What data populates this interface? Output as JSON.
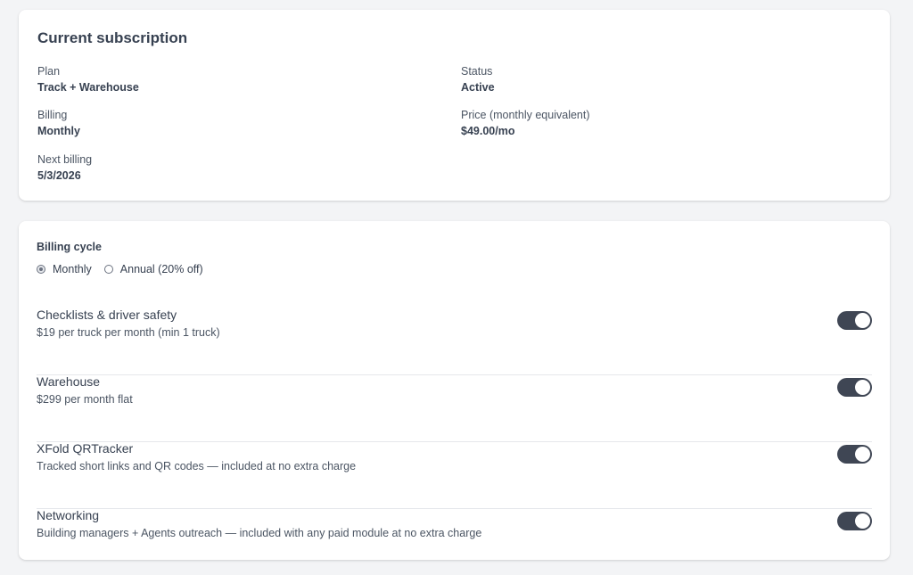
{
  "subscription": {
    "title": "Current subscription",
    "plan": {
      "label": "Plan",
      "value": "Track + Warehouse"
    },
    "status": {
      "label": "Status",
      "value": "Active"
    },
    "billing": {
      "label": "Billing",
      "value": "Monthly"
    },
    "price": {
      "label": "Price (monthly equivalent)",
      "value": "$49.00/mo"
    },
    "next_billing": {
      "label": "Next billing",
      "value": "5/3/2026"
    }
  },
  "billing_cycle": {
    "label": "Billing cycle",
    "options": [
      {
        "label": "Monthly",
        "selected": true
      },
      {
        "label": "Annual (20% off)",
        "selected": false
      }
    ]
  },
  "modules": [
    {
      "name": "Checklists & driver safety",
      "description": "$19 per truck per month (min 1 truck)",
      "enabled": true
    },
    {
      "name": "Warehouse",
      "description": "$299 per month flat",
      "enabled": true
    },
    {
      "name": "XFold QRTracker",
      "description": "Tracked short links and QR codes — included at no extra charge",
      "enabled": true
    },
    {
      "name": "Networking",
      "description": "Building managers + Agents outreach — included with any paid module at no extra charge",
      "enabled": true
    }
  ],
  "colors": {
    "toggle_on": "#3f4654",
    "background": "#f3f4f6"
  }
}
